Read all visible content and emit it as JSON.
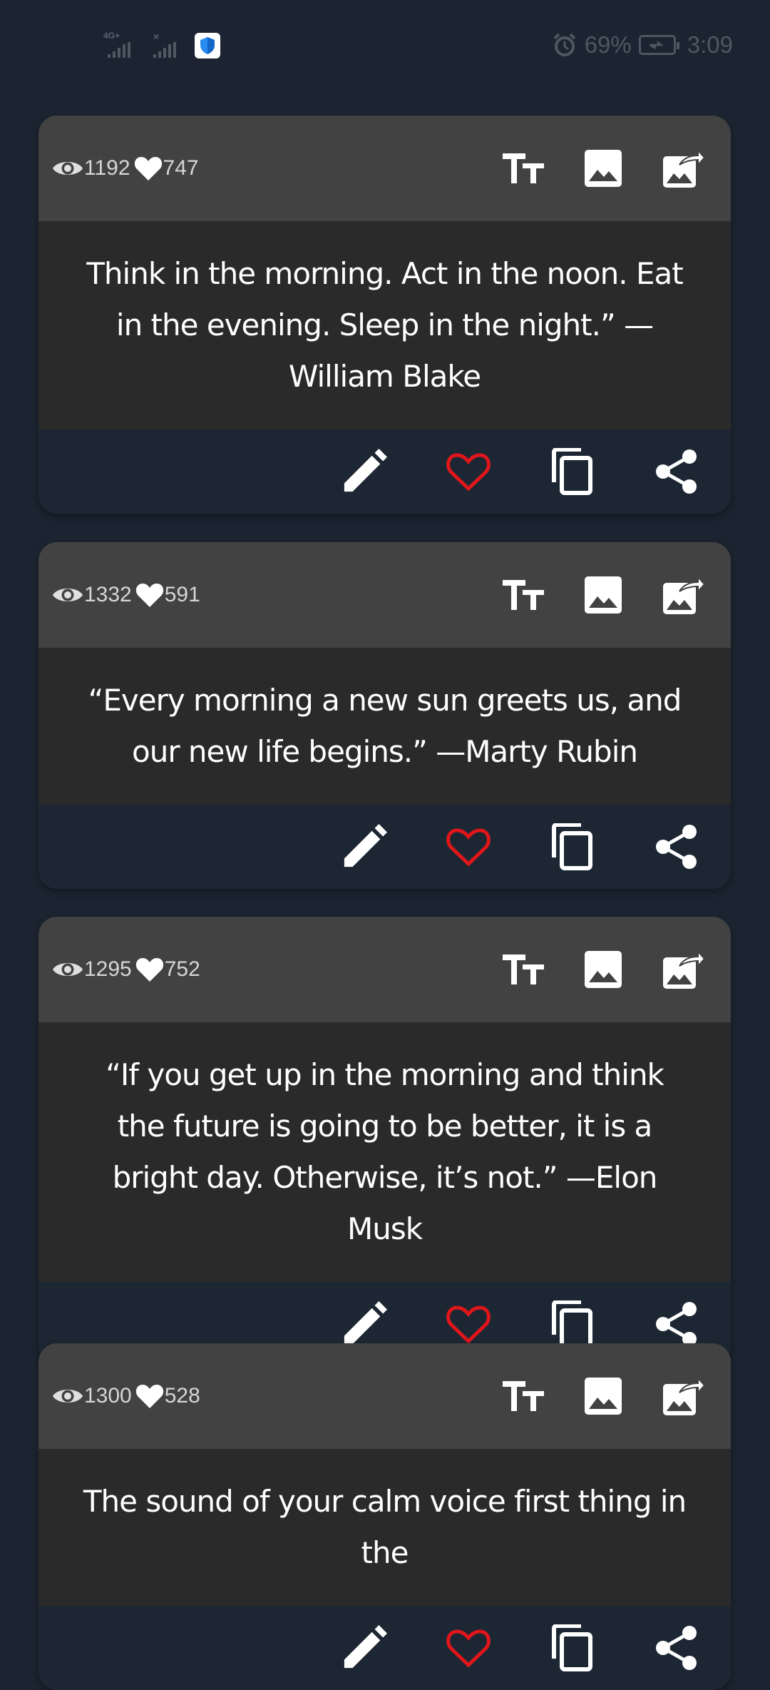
{
  "status_bar": {
    "network": "4G+",
    "battery": "69%",
    "time": "3:09",
    "icons": [
      "signal-icon",
      "no-signal-icon",
      "shield-icon",
      "alarm-icon",
      "battery-charging-icon"
    ]
  },
  "cards": [
    {
      "views": "1192",
      "likes": "747",
      "quote": "Think in the morning. Act in the noon. Eat in the evening. Sleep in the night.” —William Blake"
    },
    {
      "views": "1332",
      "likes": "591",
      "quote": "“Every morning a new sun greets us, and our new life begins.” —Marty Rubin"
    },
    {
      "views": "1295",
      "likes": "752",
      "quote": "“If you get up in the morning and think the future is going to be better, it is a bright day. Otherwise, it’s not.” —Elon Musk"
    },
    {
      "views": "1300",
      "likes": "528",
      "quote": "The sound of your calm voice first thing in the"
    }
  ],
  "icons": {
    "head": [
      "view-count-icon",
      "like-count-icon",
      "text-size-icon",
      "image-icon",
      "share-image-icon"
    ],
    "foot": [
      "edit-icon",
      "favorite-icon",
      "copy-icon",
      "share-icon"
    ]
  },
  "colors": {
    "background": "#1b2430",
    "card_header": "#424242",
    "quote_bg": "#2a2a2a",
    "favorite": "#e0161b"
  }
}
